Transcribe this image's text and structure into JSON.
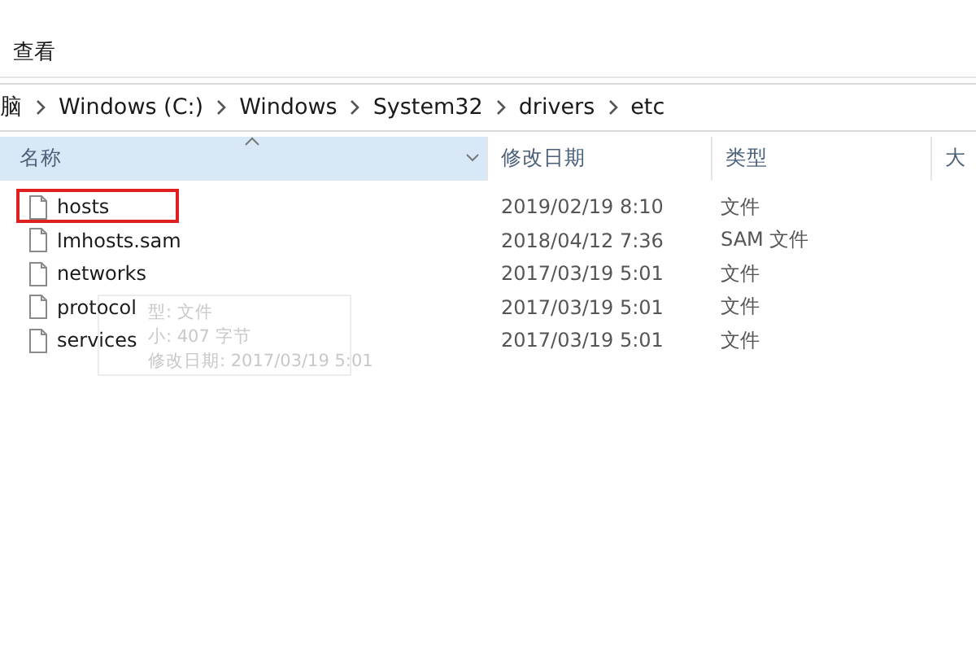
{
  "toolbar": {
    "label": "查看"
  },
  "breadcrumb": [
    "脑",
    "Windows (C:)",
    "Windows",
    "System32",
    "drivers",
    "etc"
  ],
  "columns": [
    {
      "label": "名称",
      "sorted": true
    },
    {
      "label": "修改日期",
      "sorted": false
    },
    {
      "label": "类型",
      "sorted": false
    },
    {
      "label": "大",
      "sorted": false
    }
  ],
  "files": [
    {
      "name": "hosts",
      "modified": "2019/02/19 8:10",
      "type": "文件",
      "highlighted": true
    },
    {
      "name": "lmhosts.sam",
      "modified": "2018/04/12 7:36",
      "type": "SAM 文件",
      "highlighted": false
    },
    {
      "name": "networks",
      "modified": "2017/03/19 5:01",
      "type": "文件",
      "highlighted": false
    },
    {
      "name": "protocol",
      "modified": "2017/03/19 5:01",
      "type": "文件",
      "highlighted": false
    },
    {
      "name": "services",
      "modified": "2017/03/19 5:01",
      "type": "文件",
      "highlighted": false
    }
  ],
  "tooltip": {
    "lines": [
      "型: 文件",
      "小: 407 字节",
      "修改日期: 2017/03/19 5:01"
    ]
  }
}
